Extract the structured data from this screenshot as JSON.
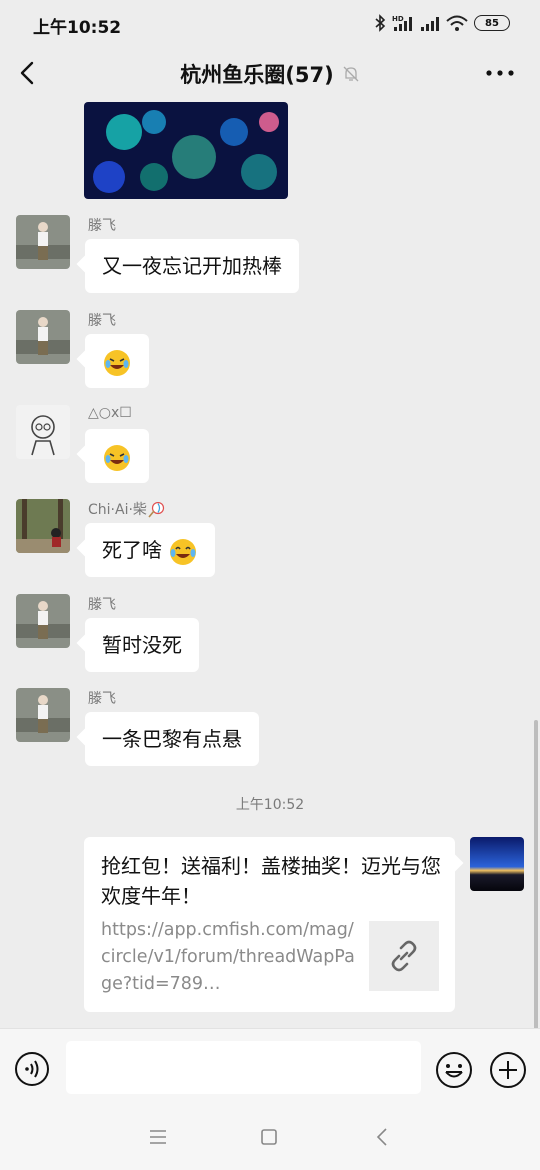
{
  "status_bar": {
    "time": "上午10:52",
    "battery": "85",
    "icons": [
      "bluetooth-icon",
      "hd-signal-icon",
      "signal-icon",
      "wifi-icon",
      "battery-icon"
    ]
  },
  "header": {
    "title": "杭州鱼乐圈(57)",
    "icons": [
      "back-arrow-icon",
      "mute-bell-icon",
      "more-dots-icon"
    ]
  },
  "messages": [
    {
      "sender": "滕飞",
      "text": "又一夜忘记开加热棒"
    },
    {
      "sender": "滕飞",
      "text": "",
      "emoji": "laughing-tears-emoji"
    },
    {
      "sender": "△○x☐",
      "text": "",
      "emoji": "laughing-tears-emoji"
    },
    {
      "sender": "Chi·Ai·柴",
      "text": "死了啥",
      "emoji": "tears-of-joy-emoji"
    },
    {
      "sender": "滕飞",
      "text": "暂时没死"
    },
    {
      "sender": "滕飞",
      "text": "一条巴黎有点悬"
    }
  ],
  "timestamp": "上午10:52",
  "link_card": {
    "title": "抢红包！送福利！盖楼抽奖！迈光与您欢度牛年！",
    "url": "https://app.cmfish.com/mag/circle/v1/forum/threadWapPage?tid=789…"
  },
  "input_bar": {
    "placeholder": "",
    "icons": [
      "voice-icon",
      "emoji-icon",
      "plus-icon"
    ]
  },
  "colors": {
    "background": "#ededed",
    "bubble": "#ffffff",
    "secondary_text": "#7a7a7a"
  }
}
